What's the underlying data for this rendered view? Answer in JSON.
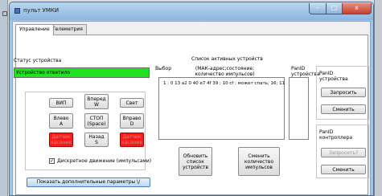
{
  "window": {
    "title": "пульт УМКИ",
    "controls": {
      "minimize": "–",
      "maximize": "□",
      "close": "x"
    }
  },
  "tabs": [
    {
      "label": "Управление",
      "active": true
    },
    {
      "label": "Телеметрия",
      "active": false
    }
  ],
  "device_status": {
    "label": "Статус устройства",
    "value": "Устройство ответило",
    "color": "#22e022"
  },
  "controls": {
    "vip": "ВИП",
    "forward": [
      "Вперед",
      "W"
    ],
    "light": "Свет",
    "left": [
      "Влево",
      "A"
    ],
    "stop": [
      "СТОП",
      "(Space)"
    ],
    "right": [
      "Вправо",
      "D"
    ],
    "sensor_left": [
      "Датчик",
      "касания"
    ],
    "back": [
      "Назад",
      "S"
    ],
    "sensor_right": [
      "Датчик",
      "касания"
    ],
    "sensor_color": "#ff1a1a",
    "discrete": {
      "label": "Дискретное движение (импульсами)",
      "checked": true
    }
  },
  "show_more_button": "Показать дополнительные параметры \\/",
  "devices": {
    "title": "Список активных устройств",
    "col_select": "Выбор",
    "col_info": [
      "(МАК-адрес;состояние;",
      "количество импульсов)"
    ],
    "col_panid": [
      "PanID",
      "устройства"
    ],
    "items": [
      "1 : 0 13 a2 0 40 e7 4f 39 ; 10 cf ; может спать; 16; 11"
    ],
    "refresh_button": [
      "Обновить",
      "список",
      "устройств"
    ],
    "change_pulses_button": [
      "Сменить",
      "количество",
      "импульсов"
    ]
  },
  "panid_device": {
    "label": [
      "PanID",
      "устройства"
    ],
    "request_button": "Запросить",
    "change_button": "Сменить"
  },
  "panid_controller": {
    "label": [
      "PanID",
      "контроллера"
    ],
    "request_button": "Запросить?",
    "change_button": "Сменить"
  }
}
